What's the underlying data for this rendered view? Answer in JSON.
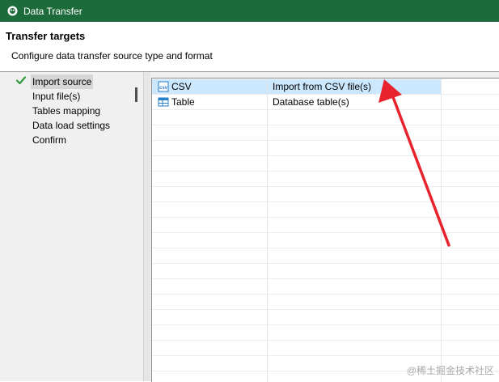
{
  "window": {
    "title": "Data Transfer",
    "icon": "dbeaver-icon"
  },
  "header": {
    "title": "Transfer targets",
    "subtitle": "Configure data transfer source type and format"
  },
  "nav": {
    "items": [
      {
        "label": "Import source",
        "selected": true,
        "checked": true
      },
      {
        "label": "Input file(s)"
      },
      {
        "label": "Tables mapping"
      },
      {
        "label": "Data load settings"
      },
      {
        "label": "Confirm"
      }
    ]
  },
  "types": {
    "rows": [
      {
        "name": "CSV",
        "description": "Import from CSV file(s)",
        "icon": "csv-file-icon",
        "selected": true
      },
      {
        "name": "Table",
        "description": "Database table(s)",
        "icon": "table-icon"
      }
    ]
  },
  "annotation": {
    "color": "#e8232d"
  },
  "watermark": "@稀土掘金技术社区"
}
